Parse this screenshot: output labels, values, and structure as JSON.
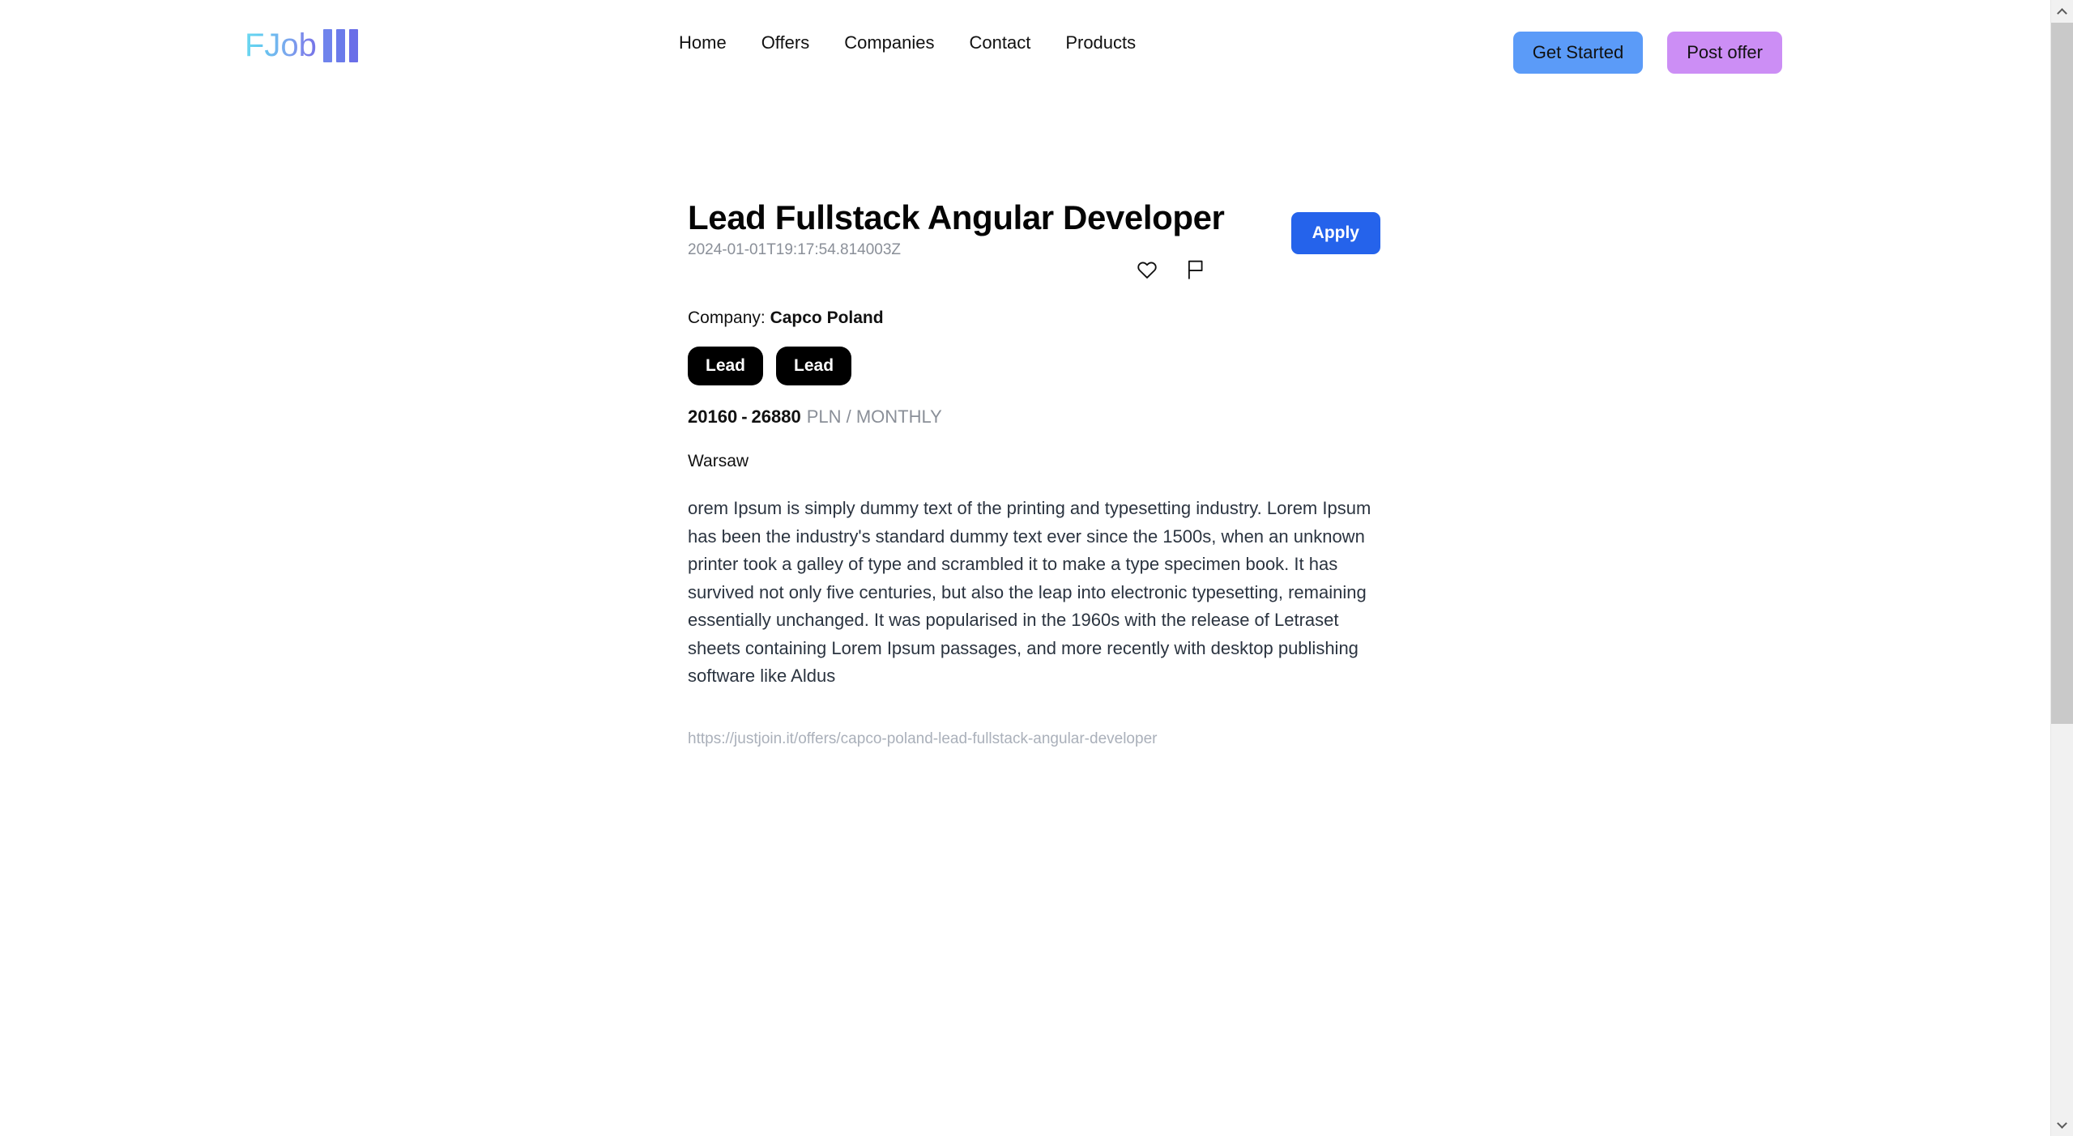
{
  "header": {
    "brand": {
      "text": "FJob",
      "bars": 3
    },
    "nav": [
      {
        "label": "Home"
      },
      {
        "label": "Offers"
      },
      {
        "label": "Companies"
      },
      {
        "label": "Contact"
      },
      {
        "label": "Products"
      }
    ],
    "get_started_label": "Get Started",
    "post_offer_label": "Post offer",
    "colors": {
      "get_started_bg": "#5b9bf8",
      "post_offer_bg": "#cc8ef5"
    }
  },
  "job": {
    "title": "Lead Fullstack Angular Developer",
    "timestamp": "2024-01-01T19:17:54.814003Z",
    "apply_label": "Apply",
    "favorite_icon": "heart-icon",
    "report_icon": "flag-icon",
    "company_label": "Company:",
    "company_name": "Capco Poland",
    "tags": [
      {
        "label": "Lead"
      },
      {
        "label": "Lead"
      }
    ],
    "salary": {
      "min": "20160",
      "dash": "-",
      "max": "26880",
      "unit": "PLN /  MONTHLY"
    },
    "location": "Warsaw",
    "description": "orem Ipsum is simply dummy text of the printing and typesetting industry. Lorem Ipsum has been the industry's standard dummy text ever since the 1500s, when an unknown printer took a galley of type and scrambled it to make a type specimen book. It has survived not only five centuries, but also the leap into electronic typesetting, remaining essentially unchanged. It was popularised in the 1960s with the release of Letraset sheets containing Lorem Ipsum passages, and more recently with desktop publishing software like Aldus",
    "source_url": "https://justjoin.it/offers/capco-poland-lead-fullstack-angular-developer",
    "apply_color": "#2563eb",
    "tag_color": "#000000"
  },
  "scrollbar": {
    "up_icon": "chevron-up-icon",
    "down_icon": "chevron-down-icon"
  }
}
